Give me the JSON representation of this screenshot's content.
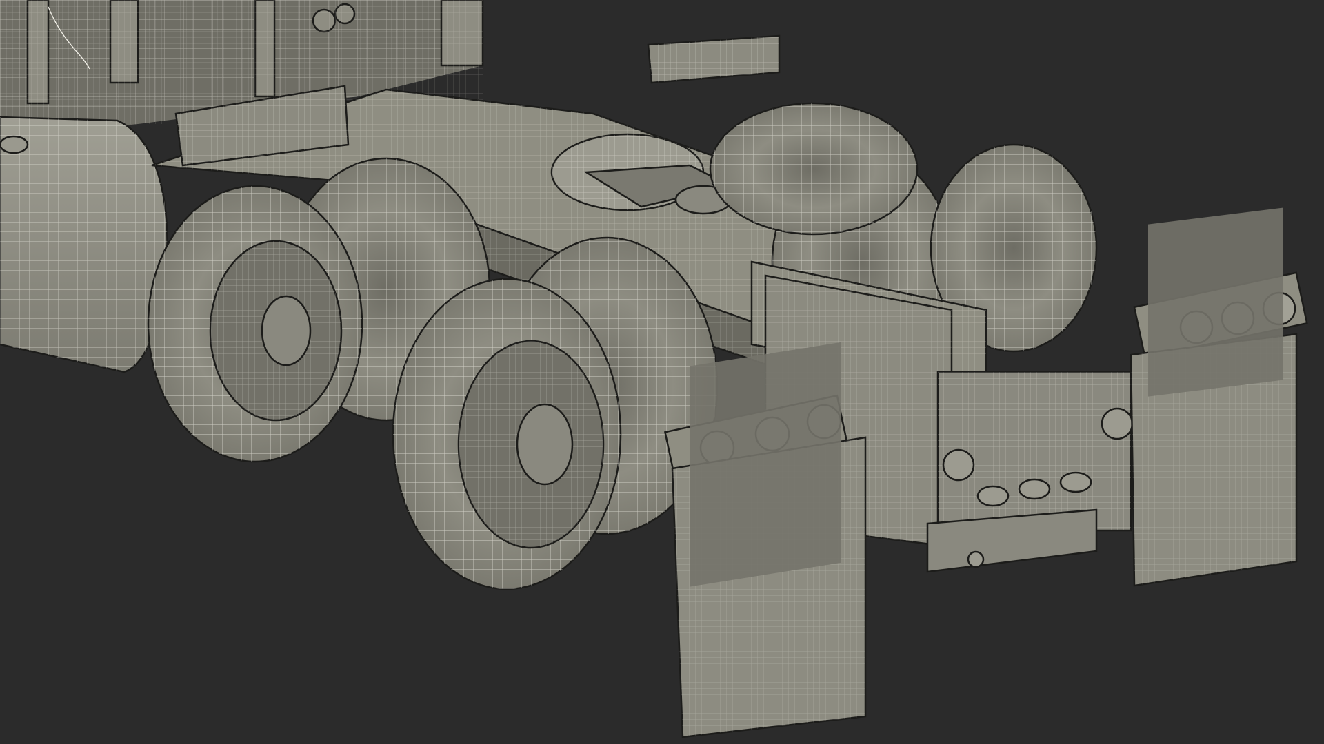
{
  "scene": {
    "subject": "truck-tractor-rear-chassis-wireframe",
    "background_color": "#2b2b2b",
    "surface_color": "#8f8e82",
    "surface_shadow_color": "#5d5c54",
    "wire_color": "#f4f2ea"
  }
}
